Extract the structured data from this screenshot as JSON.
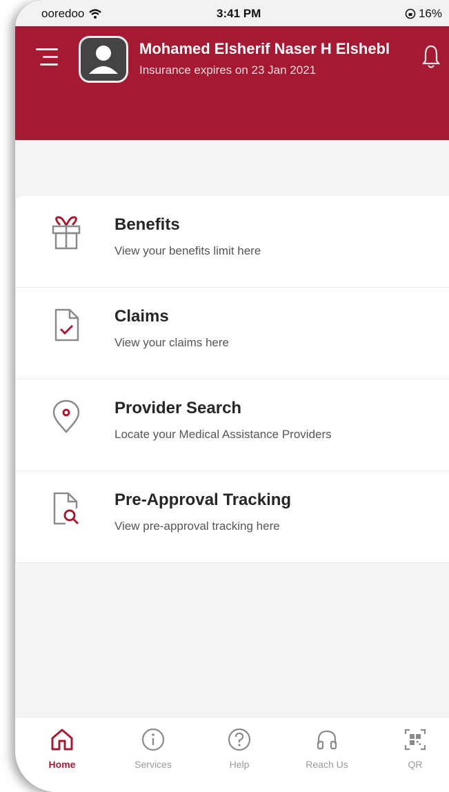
{
  "status_bar": {
    "carrier": "ooredoo",
    "time": "3:41 PM",
    "battery": "16%"
  },
  "header": {
    "user_name": "Mohamed Elsherif Naser H Elshebl",
    "insurance_text": "Insurance expires on  23 Jan 2021"
  },
  "menu": [
    {
      "title": "Benefits",
      "subtitle": "View your benefits limit here",
      "icon": "gift-icon"
    },
    {
      "title": "Claims",
      "subtitle": " View your claims here",
      "icon": "document-check-icon"
    },
    {
      "title": "Provider Search",
      "subtitle": "Locate your Medical Assistance Providers",
      "icon": "location-pin-icon"
    },
    {
      "title": "Pre-Approval Tracking",
      "subtitle": "View pre-approval tracking here",
      "icon": "document-search-icon"
    }
  ],
  "tabs": [
    {
      "label": "Home",
      "icon": "home-icon",
      "active": true
    },
    {
      "label": "Services",
      "icon": "info-icon"
    },
    {
      "label": "Help",
      "icon": "question-icon"
    },
    {
      "label": "Reach Us",
      "icon": "headphones-icon"
    },
    {
      "label": "QR",
      "icon": "qr-code-icon"
    }
  ],
  "colors": {
    "brand": "#a51932",
    "background": "#f4f4f4",
    "text_dark": "#262626"
  }
}
